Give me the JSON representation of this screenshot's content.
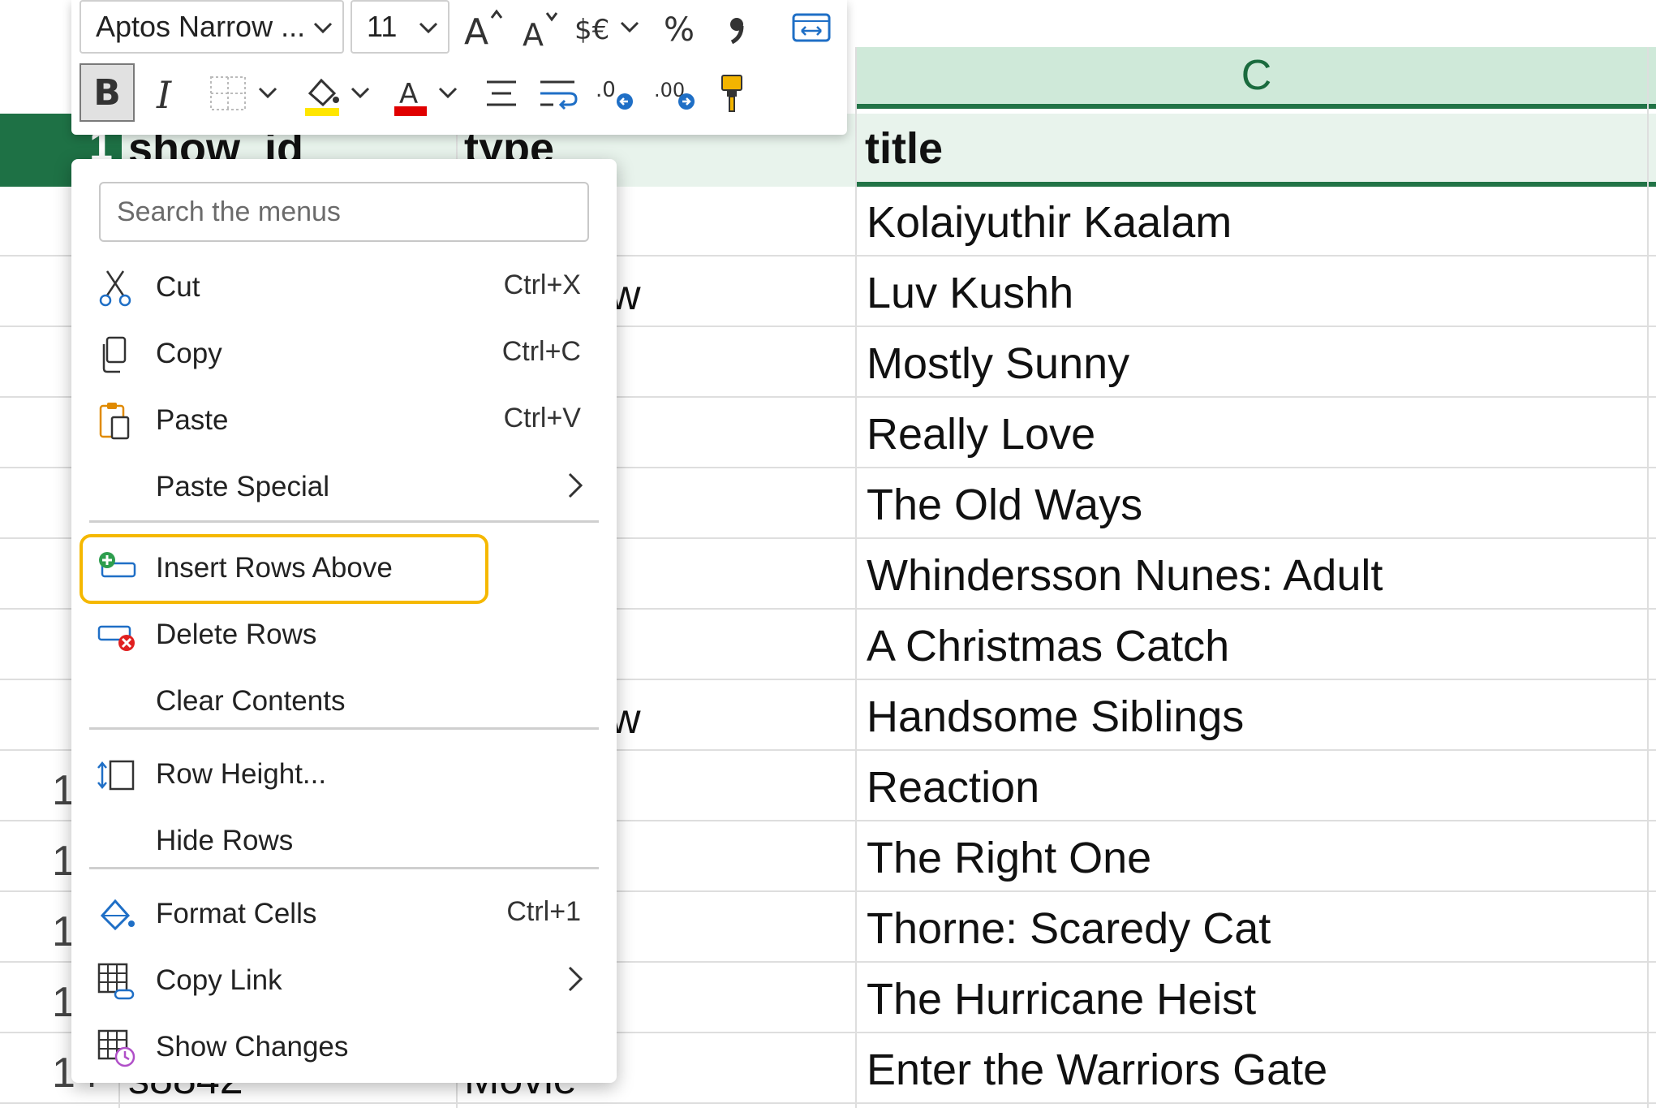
{
  "toolbar": {
    "font_name": "Aptos Narrow ...",
    "font_size": "11",
    "bold_label": "B",
    "icons": [
      "increase-font-icon",
      "decrease-font-icon",
      "currency-icon",
      "percent-icon",
      "comma-style-icon",
      "merge-center-icon",
      "italic-icon",
      "borders-icon",
      "fill-color-icon",
      "font-color-icon",
      "align-center-icon",
      "wrap-text-icon",
      "decrease-decimal-icon",
      "increase-decimal-icon",
      "format-painter-icon"
    ],
    "fill_color": "#ffe600",
    "font_color": "#e00000"
  },
  "sheet": {
    "column_c_label": "C",
    "selected_row_number": "1",
    "headers": {
      "a": "show_id",
      "b": "type",
      "c": "title"
    },
    "visible_row_numbers": [
      "1",
      "1",
      "1",
      "1",
      "14"
    ],
    "partial_col_b": [
      "w",
      "w"
    ],
    "bottom_row_a": "s8842",
    "bottom_row_b": "Movie",
    "titles": [
      "Kolaiyuthir Kaalam",
      "Luv Kushh",
      "Mostly Sunny",
      "Really Love",
      "The Old Ways",
      "Whindersson Nunes: Adult",
      "A Christmas Catch",
      "Handsome Siblings",
      "Reaction",
      "The Right One",
      "Thorne: Scaredy Cat",
      "The Hurricane Heist",
      "Enter the Warriors Gate"
    ],
    "accent_color": "#217346"
  },
  "menu": {
    "search_placeholder": "Search the menus",
    "items": [
      {
        "label": "Cut",
        "shortcut": "Ctrl+X",
        "icon": "scissors-icon"
      },
      {
        "label": "Copy",
        "shortcut": "Ctrl+C",
        "icon": "copy-icon"
      },
      {
        "label": "Paste",
        "shortcut": "Ctrl+V",
        "icon": "clipboard-icon"
      },
      {
        "label": "Paste Special",
        "shortcut": "",
        "icon": "",
        "submenu": true
      },
      {
        "label": "Insert Rows Above",
        "shortcut": "",
        "icon": "insert-rows-icon",
        "highlighted": true
      },
      {
        "label": "Delete Rows",
        "shortcut": "",
        "icon": "delete-rows-icon"
      },
      {
        "label": "Clear Contents",
        "shortcut": "",
        "icon": ""
      },
      {
        "label": "Row Height...",
        "shortcut": "",
        "icon": "row-height-icon"
      },
      {
        "label": "Hide Rows",
        "shortcut": "",
        "icon": ""
      },
      {
        "label": "Format Cells",
        "shortcut": "Ctrl+1",
        "icon": "format-cells-icon"
      },
      {
        "label": "Copy Link",
        "shortcut": "",
        "icon": "copy-link-icon",
        "submenu": true
      },
      {
        "label": "Show Changes",
        "shortcut": "",
        "icon": "show-changes-icon"
      }
    ],
    "highlight_color": "#f5b800"
  }
}
